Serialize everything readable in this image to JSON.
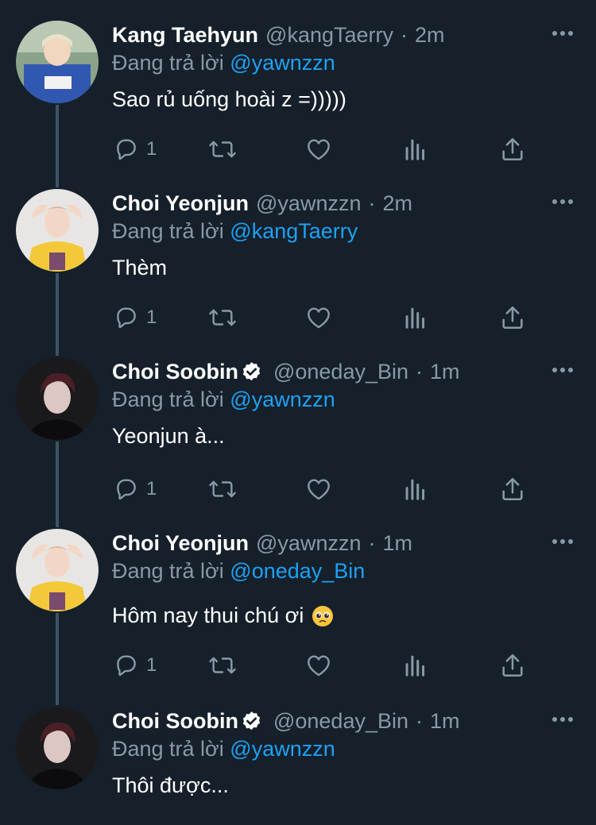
{
  "thread": {
    "tweets": [
      {
        "name": "Kang Taehyun",
        "verified": false,
        "handle": "@kangTaerry",
        "time": "2m",
        "reply_prefix": "Đang trả lời",
        "reply_to": "@yawnzzn",
        "text": "Sao rủ uống hoài z =)))))",
        "emoji": "",
        "reply_count": "1",
        "avatar": "kang-taehyun"
      },
      {
        "name": "Choi Yeonjun",
        "verified": false,
        "handle": "@yawnzzn",
        "time": "2m",
        "reply_prefix": "Đang trả lời",
        "reply_to": "@kangTaerry",
        "text": "Thèm",
        "emoji": "",
        "reply_count": "1",
        "avatar": "choi-yeonjun"
      },
      {
        "name": "Choi Soobin",
        "verified": true,
        "handle": "@oneday_Bin",
        "time": "1m",
        "reply_prefix": "Đang trả lời",
        "reply_to": "@yawnzzn",
        "text": "Yeonjun à...",
        "emoji": "",
        "reply_count": "1",
        "avatar": "choi-soobin"
      },
      {
        "name": "Choi Yeonjun",
        "verified": false,
        "handle": "@yawnzzn",
        "time": "1m",
        "reply_prefix": "Đang trả lời",
        "reply_to": "@oneday_Bin",
        "text": "Hôm nay thui chú ơi",
        "emoji": "pleading-face",
        "reply_count": "1",
        "avatar": "choi-yeonjun"
      },
      {
        "name": "Choi Soobin",
        "verified": true,
        "handle": "@oneday_Bin",
        "time": "1m",
        "reply_prefix": "Đang trả lời",
        "reply_to": "@yawnzzn",
        "text": "Thôi được...",
        "emoji": "",
        "reply_count": "",
        "avatar": "choi-soobin"
      }
    ]
  },
  "colors": {
    "background": "#15202b",
    "text_primary": "#ffffff",
    "text_secondary": "#8899a6",
    "link": "#1da1f2",
    "thread_line": "#3d5466",
    "verified_badge": "#ffffff"
  },
  "icons": {
    "reply": "reply-icon",
    "retweet": "retweet-icon",
    "like": "like-icon",
    "analytics": "analytics-icon",
    "share": "share-icon",
    "more": "more-icon",
    "verified": "verified-icon"
  }
}
